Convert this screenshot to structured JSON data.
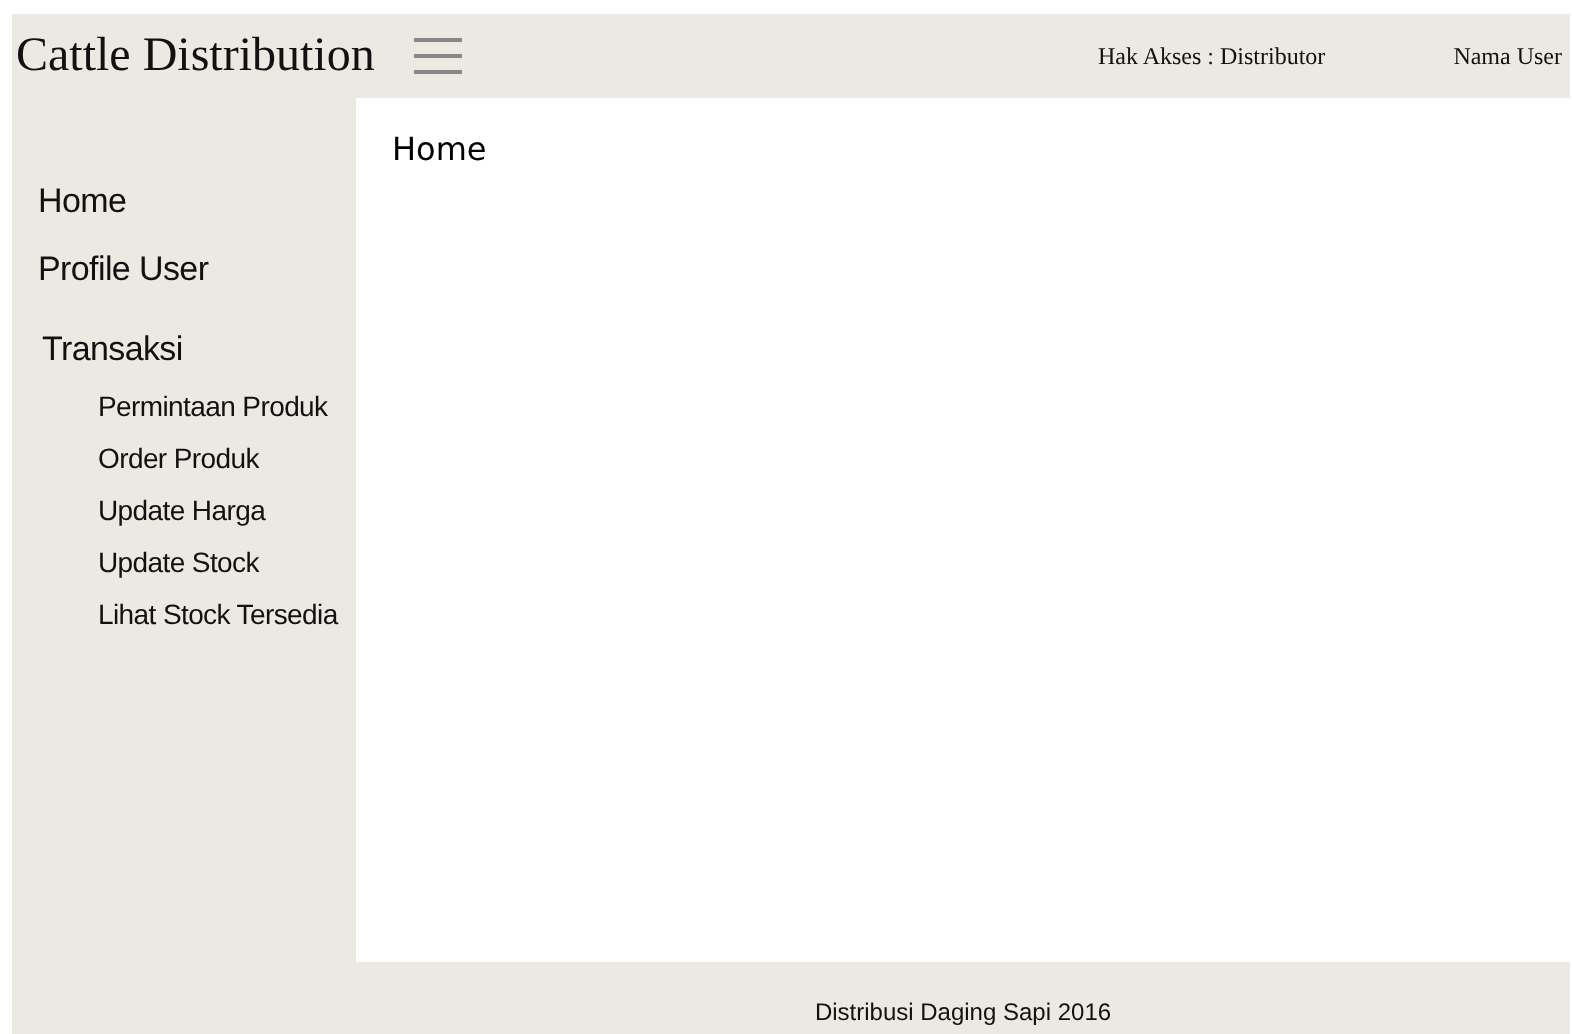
{
  "header": {
    "title": "Cattle Distribution",
    "access": "Hak Akses : Distributor",
    "user": "Nama User"
  },
  "sidebar": {
    "items": [
      {
        "label": "Home"
      },
      {
        "label": "Profile User"
      },
      {
        "label": "Transaksi",
        "children": [
          {
            "label": "Permintaan Produk"
          },
          {
            "label": "Order Produk"
          },
          {
            "label": "Update Harga"
          },
          {
            "label": "Update Stock"
          },
          {
            "label": "Lihat Stock Tersedia"
          }
        ]
      }
    ]
  },
  "content": {
    "heading": "Home"
  },
  "footer": "Distribusi Daging Sapi 2016"
}
